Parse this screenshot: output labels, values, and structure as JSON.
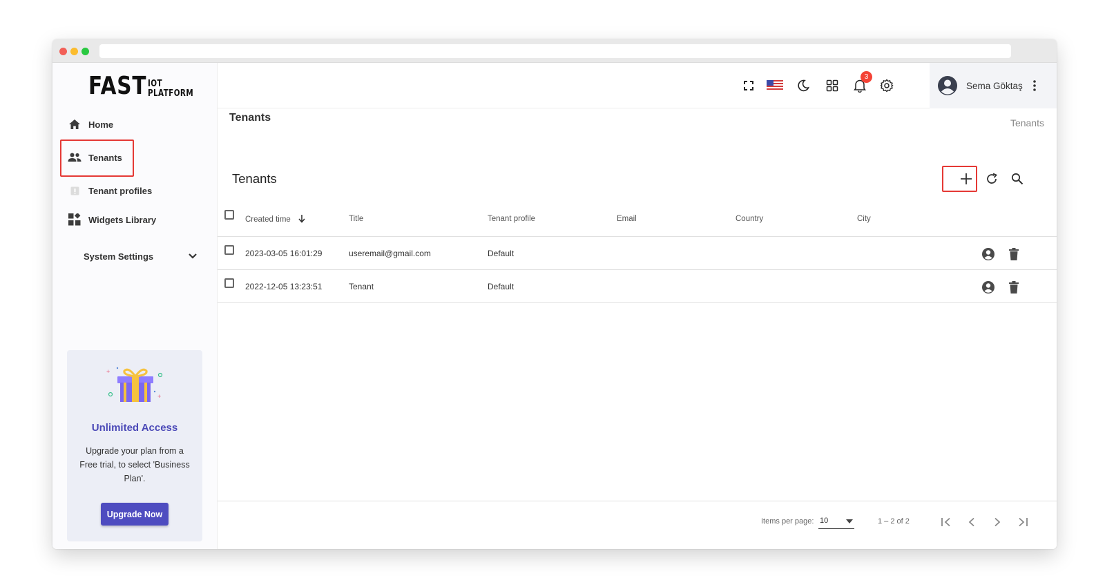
{
  "logo": {
    "main": "FAST",
    "sub": "IOT PLATFORM"
  },
  "sidebar": {
    "items": [
      {
        "label": "Home",
        "icon": "home-icon"
      },
      {
        "label": "Tenants",
        "icon": "users-icon"
      },
      {
        "label": "Tenant profiles",
        "icon": "profile-icon"
      },
      {
        "label": "Widgets Library",
        "icon": "widgets-icon"
      },
      {
        "label": "System Settings",
        "icon": "chevron-down-icon"
      }
    ],
    "promo": {
      "title": "Unlimited Access",
      "description": "Upgrade your plan from a Free trial, to select 'Business Plan'.",
      "button": "Upgrade Now"
    }
  },
  "header": {
    "notification_count": "3",
    "user_name": "Sema Göktaş"
  },
  "page": {
    "breadcrumb_title": "Tenants",
    "breadcrumb_right": "Tenants",
    "card_title": "Tenants"
  },
  "table": {
    "columns": [
      "Created time",
      "Title",
      "Tenant profile",
      "Email",
      "Country",
      "City"
    ],
    "rows": [
      {
        "created": "2023-03-05 16:01:29",
        "title": "useremail@gmail.com",
        "profile": "Default",
        "email": "",
        "country": "",
        "city": ""
      },
      {
        "created": "2022-12-05 13:23:51",
        "title": "Tenant",
        "profile": "Default",
        "email": "",
        "country": "",
        "city": ""
      }
    ]
  },
  "pagination": {
    "items_per_page_label": "Items per page:",
    "items_per_page": "10",
    "range": "1 – 2 of 2"
  },
  "colors": {
    "accent": "#4e4cc0",
    "highlight": "#e53935",
    "badge": "#f44336"
  }
}
